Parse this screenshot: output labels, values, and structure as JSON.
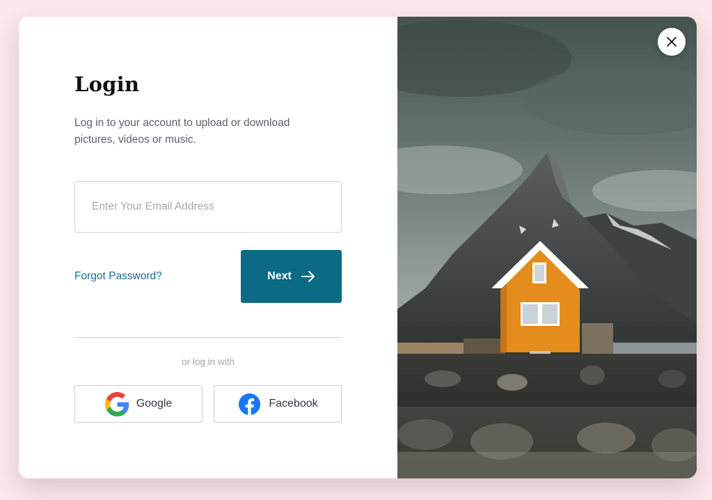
{
  "login": {
    "title": "Login",
    "description": "Log in to your account to upload or download pictures, videos or music.",
    "email_placeholder": "Enter Your Email Address",
    "email_value": "",
    "forgot_password": "Forgot Password?",
    "next_label": "Next",
    "or_text": "or log in with"
  },
  "social": {
    "google_label": "Google",
    "facebook_label": "Facebook"
  },
  "icons": {
    "close": "close-icon",
    "next_arrow": "arrow-right-icon",
    "google": "google-icon",
    "facebook": "facebook-icon"
  },
  "colors": {
    "background": "#fde7ea",
    "primary": "#0b6a85",
    "link": "#1e6f8e",
    "facebook": "#1877f2"
  }
}
